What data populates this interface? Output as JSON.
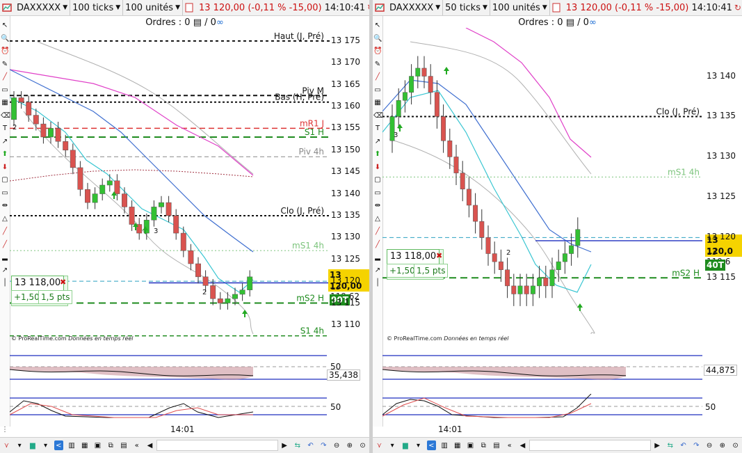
{
  "panes": [
    {
      "id": "left",
      "instrument": "DAXXXXX",
      "ticks": "100 ticks",
      "units": "100 unités",
      "quote_price": "13 120,00",
      "quote_change": "(-0,11 % -15,00)",
      "quote_time": "14:10:41",
      "orders_label": "Ordres : 0",
      "orders_sep": "/ 0",
      "credit_brand": "© ProRealTime.com",
      "credit_rt": "Données en temps réel",
      "position_price": "13 118,00",
      "position_pl": "+1,50",
      "position_pts": "1,5 pts",
      "price_tag": "13 120,00",
      "last_tag": "13 119,62",
      "qty_tag": "90T",
      "osc1_value": "35,438",
      "osc1_level": "50",
      "osc2_level": "50",
      "time_label": "14:01",
      "axis_labels": [
        "13 175",
        "13 170",
        "13 165",
        "13 160",
        "13 155",
        "13 150",
        "13 145",
        "13 140",
        "13 135",
        "13 130",
        "13 125",
        "13 120",
        "13 115",
        "13 110"
      ],
      "levels": [
        {
          "label": "Haut (J, Pré)",
          "color": "#111111"
        },
        {
          "label": "Piv M",
          "color": "#111111"
        },
        {
          "label": "Bas (H, Pré)",
          "color": "#111111"
        },
        {
          "label": "mR1 J",
          "color": "#dd3333"
        },
        {
          "label": "S1 H",
          "color": "#1e8b1e"
        },
        {
          "label": "Piv 4h",
          "color": "#111111"
        },
        {
          "label": "Clo (J, Pré)",
          "color": "#111111"
        },
        {
          "label": "mS1 4h",
          "color": "#1e8b1e"
        },
        {
          "label": "mS2 H",
          "color": "#1e8b1e"
        },
        {
          "label": "S1 4h",
          "color": "#1e8b1e"
        }
      ],
      "markers": [
        "2",
        "3",
        "2"
      ]
    },
    {
      "id": "right",
      "instrument": "DAXXXXX",
      "ticks": "50 ticks",
      "units": "100 unités",
      "quote_price": "13 120,00",
      "quote_change": "(-0,11 % -15,00)",
      "quote_time": "14:10:41",
      "orders_label": "Ordres : 0",
      "orders_sep": "/ 0",
      "credit_brand": "© ProRealTime.com",
      "credit_rt": "Données en temps réel",
      "position_price": "13 118,00",
      "position_pl": "+1,50",
      "position_pts": "1,5 pts",
      "price_tag": "13 120,0",
      "last_tag": "13 119,6",
      "qty_tag": "40T",
      "osc1_value": "44,875",
      "osc2_level": "50",
      "time_label": "14:01",
      "axis_labels": [
        "13 140",
        "13 135",
        "13 130",
        "13 125",
        "13 120",
        "13 115"
      ],
      "levels": [
        {
          "label": "Clo (J, Pré)",
          "color": "#111111"
        },
        {
          "label": "mS1 4h",
          "color": "#1e8b1e"
        },
        {
          "label": "mS2 H",
          "color": "#1e8b1e"
        }
      ],
      "markers": [
        "3",
        "2"
      ]
    }
  ],
  "colors": {
    "up": "#33c033",
    "down": "#d9534f",
    "ma_fast": "#3ac6d2",
    "ma_mid": "#3f6fd0",
    "ma_slow": "#e040c8",
    "bb": "#b0b0b0",
    "blue_line": "#1f2fbf",
    "osc_fill": "#c48a94"
  },
  "icons": [
    "pointer-icon",
    "zoom-icon",
    "alarm-icon",
    "pencil-icon",
    "line-icon",
    "trash-icon",
    "text-icon",
    "arrow-up-icon",
    "arrow-down-icon",
    "rectangle-icon",
    "fibonacci-icon",
    "triangle-icon"
  ]
}
